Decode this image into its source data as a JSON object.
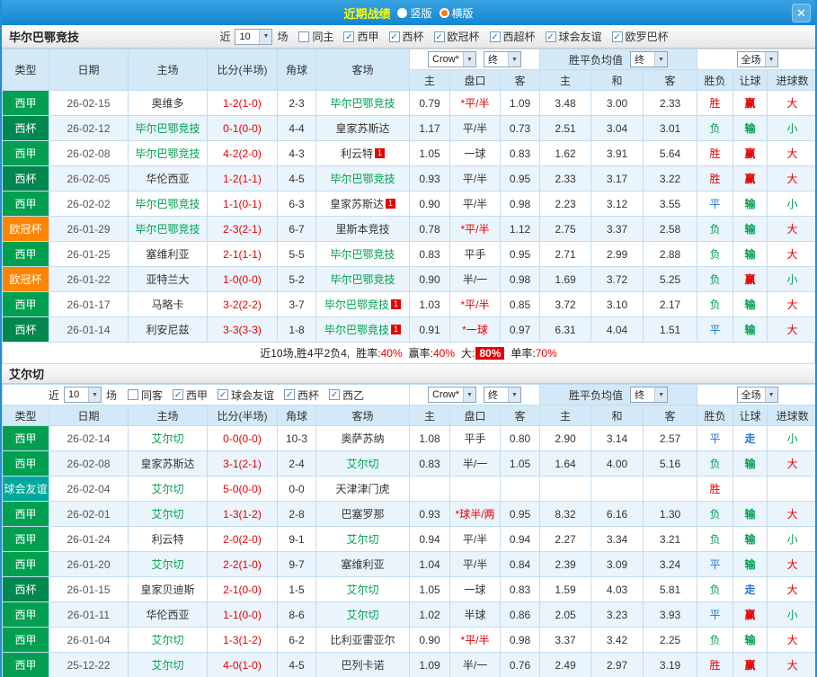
{
  "topbar": {
    "title": "近期战绩",
    "vertical_label": "竖版",
    "horizontal_label": "横版",
    "selected_layout": "横版",
    "close_glyph": "✕"
  },
  "header": {
    "bookmaker": "Crow*",
    "final": "终",
    "avg_label": "胜平负均值",
    "scope": "全场"
  },
  "cols": {
    "type": "类型",
    "date": "日期",
    "home": "主场",
    "score": "比分(半场)",
    "corner": "角球",
    "away": "客场",
    "odds_home": "主",
    "handicap": "盘口",
    "odds_away": "客",
    "avg_home": "主",
    "avg_draw": "和",
    "avg_away": "客",
    "result": "胜负",
    "let_goal": "让球",
    "goals": "进球数"
  },
  "league_colors": {
    "西甲": "#00a050",
    "西杯": "#00884f",
    "欧冠杯": "#ff8400",
    "球会友谊": "#00a99d",
    "西乙": "#3aa6dd"
  },
  "value_colors": {
    "red": "#e60000",
    "green": "#00a050",
    "blue": "#1977d2"
  },
  "section1": {
    "team": "毕尔巴鄂竞技",
    "filter": {
      "near": "近",
      "count": "10",
      "unit": "场",
      "options": [
        {
          "label": "同主",
          "checked": false
        },
        {
          "label": "西甲",
          "checked": true
        },
        {
          "label": "西杯",
          "checked": true
        },
        {
          "label": "欧冠杯",
          "checked": true
        },
        {
          "label": "西超杯",
          "checked": true
        },
        {
          "label": "球会友谊",
          "checked": true
        },
        {
          "label": "欧罗巴杯",
          "checked": true
        }
      ]
    },
    "rows": [
      {
        "type": "西甲",
        "date": "26-02-15",
        "home": "奥维多",
        "home_focus": false,
        "home_badge": "",
        "score": "1-2(1-0)",
        "corner": "2-3",
        "away": "毕尔巴鄂竞技",
        "away_focus": true,
        "away_badge": "",
        "odds_home": "0.79",
        "handicap": "*平/半",
        "handicap_red": true,
        "odds_away": "1.09",
        "avg_home": "3.48",
        "avg_draw": "3.00",
        "avg_away": "2.33",
        "result": "胜",
        "result_color": "red",
        "let": "赢",
        "let_color": "red",
        "goals": "大",
        "goals_color": "red"
      },
      {
        "type": "西杯",
        "date": "26-02-12",
        "home": "毕尔巴鄂竞技",
        "home_focus": true,
        "home_badge": "",
        "score": "0-1(0-0)",
        "corner": "4-4",
        "away": "皇家苏斯达",
        "away_focus": false,
        "away_badge": "",
        "odds_home": "1.17",
        "handicap": "平/半",
        "handicap_red": false,
        "odds_away": "0.73",
        "avg_home": "2.51",
        "avg_draw": "3.04",
        "avg_away": "3.01",
        "result": "负",
        "result_color": "green",
        "let": "输",
        "let_color": "green",
        "goals": "小",
        "goals_color": "green"
      },
      {
        "type": "西甲",
        "date": "26-02-08",
        "home": "毕尔巴鄂竞技",
        "home_focus": true,
        "home_badge": "",
        "score": "4-2(2-0)",
        "corner": "4-3",
        "away": "利云特",
        "away_focus": false,
        "away_badge": "1",
        "odds_home": "1.05",
        "handicap": "一球",
        "handicap_red": false,
        "odds_away": "0.83",
        "avg_home": "1.62",
        "avg_draw": "3.91",
        "avg_away": "5.64",
        "result": "胜",
        "result_color": "red",
        "let": "赢",
        "let_color": "red",
        "goals": "大",
        "goals_color": "red"
      },
      {
        "type": "西杯",
        "date": "26-02-05",
        "home": "华伦西亚",
        "home_focus": false,
        "home_badge": "",
        "score": "1-2(1-1)",
        "corner": "4-5",
        "away": "毕尔巴鄂竞技",
        "away_focus": true,
        "away_badge": "",
        "odds_home": "0.93",
        "handicap": "平/半",
        "handicap_red": false,
        "odds_away": "0.95",
        "avg_home": "2.33",
        "avg_draw": "3.17",
        "avg_away": "3.22",
        "result": "胜",
        "result_color": "red",
        "let": "赢",
        "let_color": "red",
        "goals": "大",
        "goals_color": "red"
      },
      {
        "type": "西甲",
        "date": "26-02-02",
        "home": "毕尔巴鄂竞技",
        "home_focus": true,
        "home_badge": "",
        "score": "1-1(0-1)",
        "corner": "6-3",
        "away": "皇家苏斯达",
        "away_focus": false,
        "away_badge": "1",
        "odds_home": "0.90",
        "handicap": "平/半",
        "handicap_red": false,
        "odds_away": "0.98",
        "avg_home": "2.23",
        "avg_draw": "3.12",
        "avg_away": "3.55",
        "result": "平",
        "result_color": "blue",
        "let": "输",
        "let_color": "green",
        "goals": "小",
        "goals_color": "green"
      },
      {
        "type": "欧冠杯",
        "date": "26-01-29",
        "home": "毕尔巴鄂竞技",
        "home_focus": true,
        "home_badge": "",
        "score": "2-3(2-1)",
        "corner": "6-7",
        "away": "里斯本竞技",
        "away_focus": false,
        "away_badge": "",
        "odds_home": "0.78",
        "handicap": "*平/半",
        "handicap_red": true,
        "odds_away": "1.12",
        "avg_home": "2.75",
        "avg_draw": "3.37",
        "avg_away": "2.58",
        "result": "负",
        "result_color": "green",
        "let": "输",
        "let_color": "green",
        "goals": "大",
        "goals_color": "red"
      },
      {
        "type": "西甲",
        "date": "26-01-25",
        "home": "塞维利亚",
        "home_focus": false,
        "home_badge": "",
        "score": "2-1(1-1)",
        "corner": "5-5",
        "away": "毕尔巴鄂竞技",
        "away_focus": true,
        "away_badge": "",
        "odds_home": "0.83",
        "handicap": "平手",
        "handicap_red": false,
        "odds_away": "0.95",
        "avg_home": "2.71",
        "avg_draw": "2.99",
        "avg_away": "2.88",
        "result": "负",
        "result_color": "green",
        "let": "输",
        "let_color": "green",
        "goals": "大",
        "goals_color": "red"
      },
      {
        "type": "欧冠杯",
        "date": "26-01-22",
        "home": "亚特兰大",
        "home_focus": false,
        "home_badge": "",
        "score": "1-0(0-0)",
        "corner": "5-2",
        "away": "毕尔巴鄂竞技",
        "away_focus": true,
        "away_badge": "",
        "odds_home": "0.90",
        "handicap": "半/一",
        "handicap_red": false,
        "odds_away": "0.98",
        "avg_home": "1.69",
        "avg_draw": "3.72",
        "avg_away": "5.25",
        "result": "负",
        "result_color": "green",
        "let": "赢",
        "let_color": "red",
        "goals": "小",
        "goals_color": "green"
      },
      {
        "type": "西甲",
        "date": "26-01-17",
        "home": "马略卡",
        "home_focus": false,
        "home_badge": "",
        "score": "3-2(2-2)",
        "corner": "3-7",
        "away": "毕尔巴鄂竞技",
        "away_focus": true,
        "away_badge": "1",
        "odds_home": "1.03",
        "handicap": "*平/半",
        "handicap_red": true,
        "odds_away": "0.85",
        "avg_home": "3.72",
        "avg_draw": "3.10",
        "avg_away": "2.17",
        "result": "负",
        "result_color": "green",
        "let": "输",
        "let_color": "green",
        "goals": "大",
        "goals_color": "red"
      },
      {
        "type": "西杯",
        "date": "26-01-14",
        "home": "利安尼兹",
        "home_focus": false,
        "home_badge": "",
        "score": "3-3(3-3)",
        "corner": "1-8",
        "away": "毕尔巴鄂竞技",
        "away_focus": true,
        "away_badge": "1",
        "odds_home": "0.91",
        "handicap": "*一球",
        "handicap_red": true,
        "odds_away": "0.97",
        "avg_home": "6.31",
        "avg_draw": "4.04",
        "avg_away": "1.51",
        "result": "平",
        "result_color": "blue",
        "let": "输",
        "let_color": "green",
        "goals": "大",
        "goals_color": "red"
      }
    ],
    "summary": {
      "prefix": "近10场,胜4平2负4,",
      "items": [
        {
          "label": "胜率:",
          "value": "40%",
          "highlight": false
        },
        {
          "label": "赢率:",
          "value": "40%",
          "highlight": false
        },
        {
          "label": "大:",
          "value": "80%",
          "highlight": true
        },
        {
          "label": "单率:",
          "value": "70%",
          "highlight": false
        }
      ]
    }
  },
  "section2": {
    "team": "艾尔切",
    "filter": {
      "near": "近",
      "count": "10",
      "unit": "场",
      "options": [
        {
          "label": "同客",
          "checked": false
        },
        {
          "label": "西甲",
          "checked": true
        },
        {
          "label": "球会友谊",
          "checked": true
        },
        {
          "label": "西杯",
          "checked": true
        },
        {
          "label": "西乙",
          "checked": true
        }
      ]
    },
    "rows": [
      {
        "type": "西甲",
        "date": "26-02-14",
        "home": "艾尔切",
        "home_focus": true,
        "home_badge": "",
        "score": "0-0(0-0)",
        "corner": "10-3",
        "away": "奥萨苏纳",
        "away_focus": false,
        "away_badge": "",
        "odds_home": "1.08",
        "handicap": "平手",
        "handicap_red": false,
        "odds_away": "0.80",
        "avg_home": "2.90",
        "avg_draw": "3.14",
        "avg_away": "2.57",
        "result": "平",
        "result_color": "blue",
        "let": "走",
        "let_color": "blue",
        "goals": "小",
        "goals_color": "green"
      },
      {
        "type": "西甲",
        "date": "26-02-08",
        "home": "皇家苏斯达",
        "home_focus": false,
        "home_badge": "",
        "score": "3-1(2-1)",
        "corner": "2-4",
        "away": "艾尔切",
        "away_focus": true,
        "away_badge": "",
        "odds_home": "0.83",
        "handicap": "半/一",
        "handicap_red": false,
        "odds_away": "1.05",
        "avg_home": "1.64",
        "avg_draw": "4.00",
        "avg_away": "5.16",
        "result": "负",
        "result_color": "green",
        "let": "输",
        "let_color": "green",
        "goals": "大",
        "goals_color": "red"
      },
      {
        "type": "球会友谊",
        "date": "26-02-04",
        "home": "艾尔切",
        "home_focus": true,
        "home_badge": "",
        "score": "5-0(0-0)",
        "corner": "0-0",
        "away": "天津津门虎",
        "away_focus": false,
        "away_badge": "",
        "odds_home": "",
        "handicap": "",
        "handicap_red": false,
        "odds_away": "",
        "avg_home": "",
        "avg_draw": "",
        "avg_away": "",
        "result": "胜",
        "result_color": "red",
        "let": "",
        "let_color": "",
        "goals": "",
        "goals_color": ""
      },
      {
        "type": "西甲",
        "date": "26-02-01",
        "home": "艾尔切",
        "home_focus": true,
        "home_badge": "",
        "score": "1-3(1-2)",
        "corner": "2-8",
        "away": "巴塞罗那",
        "away_focus": false,
        "away_badge": "",
        "odds_home": "0.93",
        "handicap": "*球半/两",
        "handicap_red": true,
        "odds_away": "0.95",
        "avg_home": "8.32",
        "avg_draw": "6.16",
        "avg_away": "1.30",
        "result": "负",
        "result_color": "green",
        "let": "输",
        "let_color": "green",
        "goals": "大",
        "goals_color": "red"
      },
      {
        "type": "西甲",
        "date": "26-01-24",
        "home": "利云特",
        "home_focus": false,
        "home_badge": "",
        "score": "2-0(2-0)",
        "corner": "9-1",
        "away": "艾尔切",
        "away_focus": true,
        "away_badge": "",
        "odds_home": "0.94",
        "handicap": "平/半",
        "handicap_red": false,
        "odds_away": "0.94",
        "avg_home": "2.27",
        "avg_draw": "3.34",
        "avg_away": "3.21",
        "result": "负",
        "result_color": "green",
        "let": "输",
        "let_color": "green",
        "goals": "小",
        "goals_color": "green"
      },
      {
        "type": "西甲",
        "date": "26-01-20",
        "home": "艾尔切",
        "home_focus": true,
        "home_badge": "",
        "score": "2-2(1-0)",
        "corner": "9-7",
        "away": "塞维利亚",
        "away_focus": false,
        "away_badge": "",
        "odds_home": "1.04",
        "handicap": "平/半",
        "handicap_red": false,
        "odds_away": "0.84",
        "avg_home": "2.39",
        "avg_draw": "3.09",
        "avg_away": "3.24",
        "result": "平",
        "result_color": "blue",
        "let": "输",
        "let_color": "green",
        "goals": "大",
        "goals_color": "red"
      },
      {
        "type": "西杯",
        "date": "26-01-15",
        "home": "皇家贝迪斯",
        "home_focus": false,
        "home_badge": "",
        "score": "2-1(0-0)",
        "corner": "1-5",
        "away": "艾尔切",
        "away_focus": true,
        "away_badge": "",
        "odds_home": "1.05",
        "handicap": "一球",
        "handicap_red": false,
        "odds_away": "0.83",
        "avg_home": "1.59",
        "avg_draw": "4.03",
        "avg_away": "5.81",
        "result": "负",
        "result_color": "green",
        "let": "走",
        "let_color": "blue",
        "goals": "大",
        "goals_color": "red"
      },
      {
        "type": "西甲",
        "date": "26-01-11",
        "home": "华伦西亚",
        "home_focus": false,
        "home_badge": "",
        "score": "1-1(0-0)",
        "corner": "8-6",
        "away": "艾尔切",
        "away_focus": true,
        "away_badge": "",
        "odds_home": "1.02",
        "handicap": "半球",
        "handicap_red": false,
        "odds_away": "0.86",
        "avg_home": "2.05",
        "avg_draw": "3.23",
        "avg_away": "3.93",
        "result": "平",
        "result_color": "blue",
        "let": "赢",
        "let_color": "red",
        "goals": "小",
        "goals_color": "green"
      },
      {
        "type": "西甲",
        "date": "26-01-04",
        "home": "艾尔切",
        "home_focus": true,
        "home_badge": "",
        "score": "1-3(1-2)",
        "corner": "6-2",
        "away": "比利亚雷亚尔",
        "away_focus": false,
        "away_badge": "",
        "odds_home": "0.90",
        "handicap": "*平/半",
        "handicap_red": true,
        "odds_away": "0.98",
        "avg_home": "3.37",
        "avg_draw": "3.42",
        "avg_away": "2.25",
        "result": "负",
        "result_color": "green",
        "let": "输",
        "let_color": "green",
        "goals": "大",
        "goals_color": "red"
      },
      {
        "type": "西甲",
        "date": "25-12-22",
        "home": "艾尔切",
        "home_focus": true,
        "home_badge": "",
        "score": "4-0(1-0)",
        "corner": "4-5",
        "away": "巴列卡诺",
        "away_focus": false,
        "away_badge": "",
        "odds_home": "1.09",
        "handicap": "半/一",
        "handicap_red": false,
        "odds_away": "0.76",
        "avg_home": "2.49",
        "avg_draw": "2.97",
        "avg_away": "3.19",
        "result": "胜",
        "result_color": "red",
        "let": "赢",
        "let_color": "red",
        "goals": "大",
        "goals_color": "red"
      }
    ]
  }
}
